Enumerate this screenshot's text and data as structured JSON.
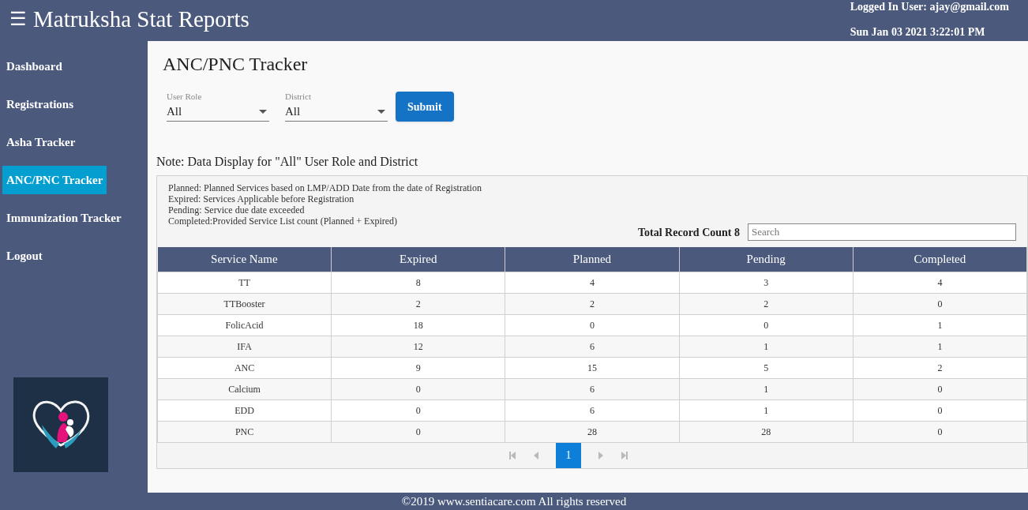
{
  "header": {
    "menu_icon": "☰",
    "title": "Matruksha Stat Reports",
    "user": "Logged In User: ajay@gmail.com",
    "datetime": "Sun Jan 03 2021 3:22:01 PM"
  },
  "sidebar": {
    "items": [
      {
        "label": "Dashboard",
        "selected": false
      },
      {
        "label": "Registrations",
        "selected": false
      },
      {
        "label": "Asha Tracker",
        "selected": false
      },
      {
        "label": "ANC/PNC Tracker",
        "selected": true
      },
      {
        "label": "Immunization Tracker",
        "selected": false
      },
      {
        "label": "Logout",
        "selected": false
      }
    ]
  },
  "page_title": "ANC/PNC Tracker",
  "filters": [
    {
      "label": "User Role",
      "value": "All"
    },
    {
      "label": "District",
      "value": "All"
    }
  ],
  "submit": "Submit",
  "note": "Note: Data Display for \"All\" User Role and District",
  "legend": [
    "Planned: Planned Services based on LMP/ADD Date from the date of Registration",
    "Expired: Services Applicable before Registration",
    "Pending: Service due date exceeded",
    "Completed:Provided Service List count (Planned + Expired)"
  ],
  "record_count": "Total Record Count 8",
  "search": {
    "placeholder": "Search"
  },
  "table": {
    "columns": [
      "Service Name",
      "Expired",
      "Planned",
      "Pending",
      "Completed"
    ],
    "rows": [
      [
        "TT",
        "8",
        "4",
        "3",
        "4"
      ],
      [
        "TTBooster",
        "2",
        "2",
        "2",
        "0"
      ],
      [
        "FolicAcid",
        "18",
        "0",
        "0",
        "1"
      ],
      [
        "IFA",
        "12",
        "6",
        "1",
        "1"
      ],
      [
        "ANC",
        "9",
        "15",
        "5",
        "2"
      ],
      [
        "Calcium",
        "0",
        "6",
        "1",
        "0"
      ],
      [
        "EDD",
        "0",
        "6",
        "1",
        "0"
      ],
      [
        "PNC",
        "0",
        "28",
        "28",
        "0"
      ]
    ]
  },
  "pagination": {
    "pages": [
      {
        "label": "1",
        "selected": true
      }
    ]
  },
  "footer": "©2019 www.sentiacare.com All rights reserved"
}
